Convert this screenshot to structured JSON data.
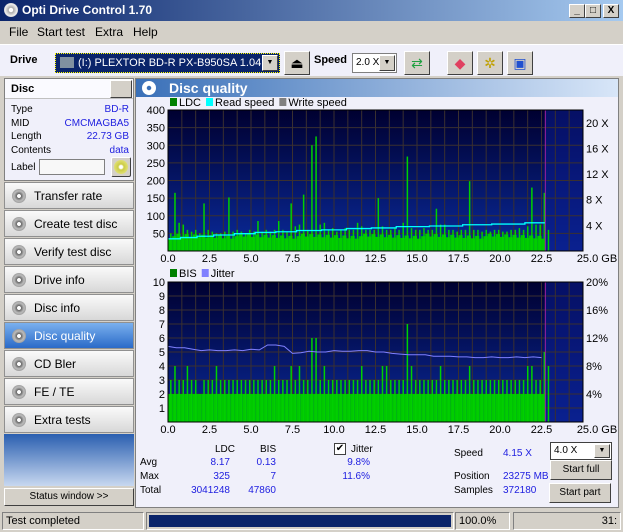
{
  "window": {
    "title": "Opti Drive Control 1.70",
    "controls": [
      "_",
      "□",
      "X"
    ]
  },
  "menu": [
    "File",
    "Start test",
    "Extra",
    "Help"
  ],
  "toolbar": {
    "drive_label": "Drive",
    "drive_value": "(I:)   PLEXTOR BD-R  PX-B950SA 1.04",
    "speed_label": "Speed",
    "speed_value": "2.0 X"
  },
  "disc": {
    "title": "Disc",
    "type_label": "Type",
    "type": "BD-R",
    "mid_label": "MID",
    "mid": "CMCMAGBA5",
    "length_label": "Length",
    "length": "22.73 GB",
    "contents_label": "Contents",
    "contents": "data",
    "label_label": "Label",
    "label_value": ""
  },
  "nav": [
    {
      "label": "Transfer rate"
    },
    {
      "label": "Create test disc"
    },
    {
      "label": "Verify test disc"
    },
    {
      "label": "Drive info"
    },
    {
      "label": "Disc info"
    },
    {
      "label": "Disc quality",
      "selected": true
    },
    {
      "label": "CD Bler"
    },
    {
      "label": "FE / TE"
    },
    {
      "label": "Extra tests"
    }
  ],
  "status_window_label": "Status window >>",
  "panel_title": "Disc quality",
  "colors": {
    "ldc": "#00c800",
    "read_speed": "#00ffff",
    "write_speed": "#808080",
    "bis": "#00c800",
    "jitter": "#8080ff",
    "plot_bg": "#000850",
    "selected_nav": "#2a6ac8"
  },
  "chart_data": [
    {
      "type": "bar",
      "legend": [
        "LDC",
        "Read speed",
        "Write speed"
      ],
      "x_ticks": [
        "0.0",
        "2.5",
        "5.0",
        "7.5",
        "10.0",
        "12.5",
        "15.0",
        "17.5",
        "20.0",
        "22.5",
        "25.0 GB"
      ],
      "xlim": [
        0,
        25
      ],
      "ylim": [
        0,
        400
      ],
      "y_ticks": [
        "400",
        "350",
        "300",
        "250",
        "200",
        "150",
        "100",
        "50"
      ],
      "y2lim": [
        0,
        22
      ],
      "y2_ticks": [
        "20 X",
        "16 X",
        "12 X",
        "8 X",
        "4 X"
      ],
      "grid": true,
      "legend_position": "top-left",
      "x_step": 0.25,
      "ldc": [
        50,
        165,
        80,
        75,
        60,
        55,
        60,
        50,
        135,
        60,
        55,
        50,
        50,
        55,
        152,
        55,
        60,
        55,
        50,
        60,
        55,
        85,
        55,
        60,
        55,
        60,
        85,
        60,
        55,
        135,
        70,
        75,
        160,
        60,
        300,
        325,
        75,
        80,
        60,
        65,
        55,
        60,
        65,
        60,
        60,
        80,
        70,
        60,
        60,
        60,
        150,
        70,
        60,
        60,
        65,
        60,
        80,
        268,
        65,
        60,
        60,
        65,
        60,
        60,
        120,
        75,
        75,
        60,
        60,
        55,
        60,
        60,
        198,
        60,
        60,
        55,
        60,
        55,
        60,
        60,
        55,
        55,
        60,
        60,
        65,
        60,
        70,
        180,
        75,
        75,
        165,
        60
      ],
      "read_speed": {
        "x": [
          0,
          0.75,
          1.75,
          2.75,
          4,
          5.25,
          6.5,
          7.75,
          9.25,
          10.75,
          12.25,
          13.75,
          15.75,
          17.75,
          19.5,
          21.5,
          22.73
        ],
        "y": [
          1.9,
          2.1,
          2.3,
          2.5,
          2.7,
          2.9,
          3.0,
          3.2,
          3.3,
          3.5,
          3.6,
          3.8,
          3.9,
          4.1,
          4.2,
          4.4,
          4.4
        ]
      }
    },
    {
      "type": "bar",
      "legend": [
        "BIS",
        "Jitter"
      ],
      "x_ticks": [
        "0.0",
        "2.5",
        "5.0",
        "7.5",
        "10.0",
        "12.5",
        "15.0",
        "17.5",
        "20.0",
        "22.5",
        "25.0 GB"
      ],
      "xlim": [
        0,
        25
      ],
      "ylim": [
        0,
        10
      ],
      "y_ticks": [
        "10",
        "9",
        "8",
        "7",
        "6",
        "5",
        "4",
        "3",
        "2",
        "1"
      ],
      "y2lim": [
        0,
        20
      ],
      "y2_ticks": [
        "20%",
        "16%",
        "12%",
        "8%",
        "4%"
      ],
      "grid": true,
      "legend_position": "top-left",
      "x_step": 0.25,
      "bis": [
        3,
        4,
        3,
        3,
        4,
        3,
        3,
        2,
        3,
        3,
        3,
        4,
        3,
        3,
        3,
        3,
        3,
        3,
        3,
        3,
        3,
        3,
        3,
        3,
        3,
        4,
        3,
        3,
        3,
        4,
        3,
        4,
        3,
        3,
        6,
        6,
        3,
        4,
        3,
        3,
        3,
        3,
        3,
        3,
        3,
        3,
        4,
        3,
        3,
        3,
        3,
        4,
        4,
        3,
        3,
        3,
        3,
        7,
        4,
        3,
        3,
        3,
        3,
        3,
        3,
        4,
        3,
        3,
        3,
        3,
        3,
        3,
        4,
        3,
        3,
        3,
        3,
        3,
        3,
        3,
        3,
        3,
        3,
        3,
        3,
        3,
        4,
        4,
        3,
        3,
        5,
        4
      ],
      "jitter": {
        "x_step": 0.5,
        "y": [
          10.8,
          10.6,
          10.6,
          10.4,
          10.2,
          10.3,
          10.2,
          10.2,
          10.3,
          10.2,
          10.4,
          10.3,
          11.0,
          11.0,
          10.8,
          9.8,
          9.9,
          10.1,
          10.0,
          10.0,
          10.2,
          10.1,
          10.1,
          10.2,
          10.2,
          10.0,
          10.0,
          9.8,
          9.7,
          9.6,
          9.6,
          9.6,
          9.4,
          9.4,
          9.4,
          9.3,
          9.3,
          9.2,
          9.2,
          9.3,
          9.2,
          9.2,
          9.3,
          9.2,
          9.3,
          9.2
        ]
      }
    }
  ],
  "stats": {
    "col_ldc": "LDC",
    "col_bis": "BIS",
    "avg_label": "Avg",
    "max_label": "Max",
    "total_label": "Total",
    "avg_ldc": "8.17",
    "avg_bis": "0.13",
    "max_ldc": "325",
    "max_bis": "7",
    "total_ldc": "3041248",
    "total_bis": "47860",
    "jitter_label": "Jitter",
    "jitter_checked": true,
    "avg_jitter": "9.8%",
    "max_jitter": "11.6%"
  },
  "run": {
    "speed_label": "Speed",
    "speed": "4.15 X",
    "position_label": "Position",
    "position": "23275 MB",
    "samples_label": "Samples",
    "samples": "372180",
    "speed_select": "4.0 X",
    "start_full": "Start full",
    "start_part": "Start part"
  },
  "statusbar": {
    "text": "Test completed",
    "progress": 100,
    "progress_text": "100.0%",
    "time": "31:"
  }
}
